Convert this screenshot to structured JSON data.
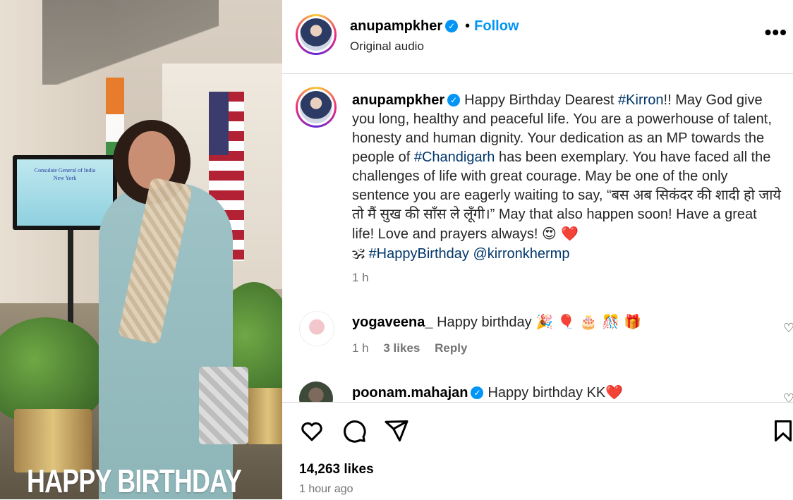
{
  "media": {
    "overlay_text": "HAPPY BIRTHDAY",
    "tv_lines": [
      "Consulate General of India",
      "New York"
    ]
  },
  "header": {
    "username": "anupampkher",
    "verified_badge": "verified-badge",
    "separator": "•",
    "follow_label": "Follow",
    "audio": "Original audio",
    "more_label": "•••"
  },
  "caption": {
    "username": "anupampkher",
    "text_1": "Happy Birthday Dearest ",
    "tag_1": "#Kirron",
    "text_2": "!! May God give you long, healthy and peaceful life. You are a powerhouse of talent, honesty and human dignity. Your dedication as an MP towards the people of ",
    "tag_2": "#Chandigarh",
    "text_3": " has been exemplary. You have faced all the challenges of life with great courage. May be one of the only sentence you are eagerly waiting to say, “बस अब सिकंदर की शादी हो जाये तो मैं सुख की साँस ले लूँगी।” May that also happen soon! Have a great life! Love and prayers always! ",
    "emojis_1": "😍 ❤️",
    "emoji_om": "🕉",
    "tag_3": "#HappyBirthday",
    "mention": "@kirronkhermp",
    "time": "1 h"
  },
  "comments": [
    {
      "username": "yogaveena_",
      "text": "Happy birthday",
      "emojis": "🎉 🎈 🎂 🎊 🎁",
      "time": "1 h",
      "likes": "3 likes",
      "reply": "Reply"
    },
    {
      "username": "poonam.mahajan",
      "text": "Happy birthday KK",
      "emojis": "❤️"
    }
  ],
  "actions": {
    "likes": "14,263 likes",
    "time_ago": "1 hour ago"
  },
  "colors": {
    "link_blue": "#0095f6",
    "hashtag": "#00376b",
    "muted": "#737373"
  }
}
